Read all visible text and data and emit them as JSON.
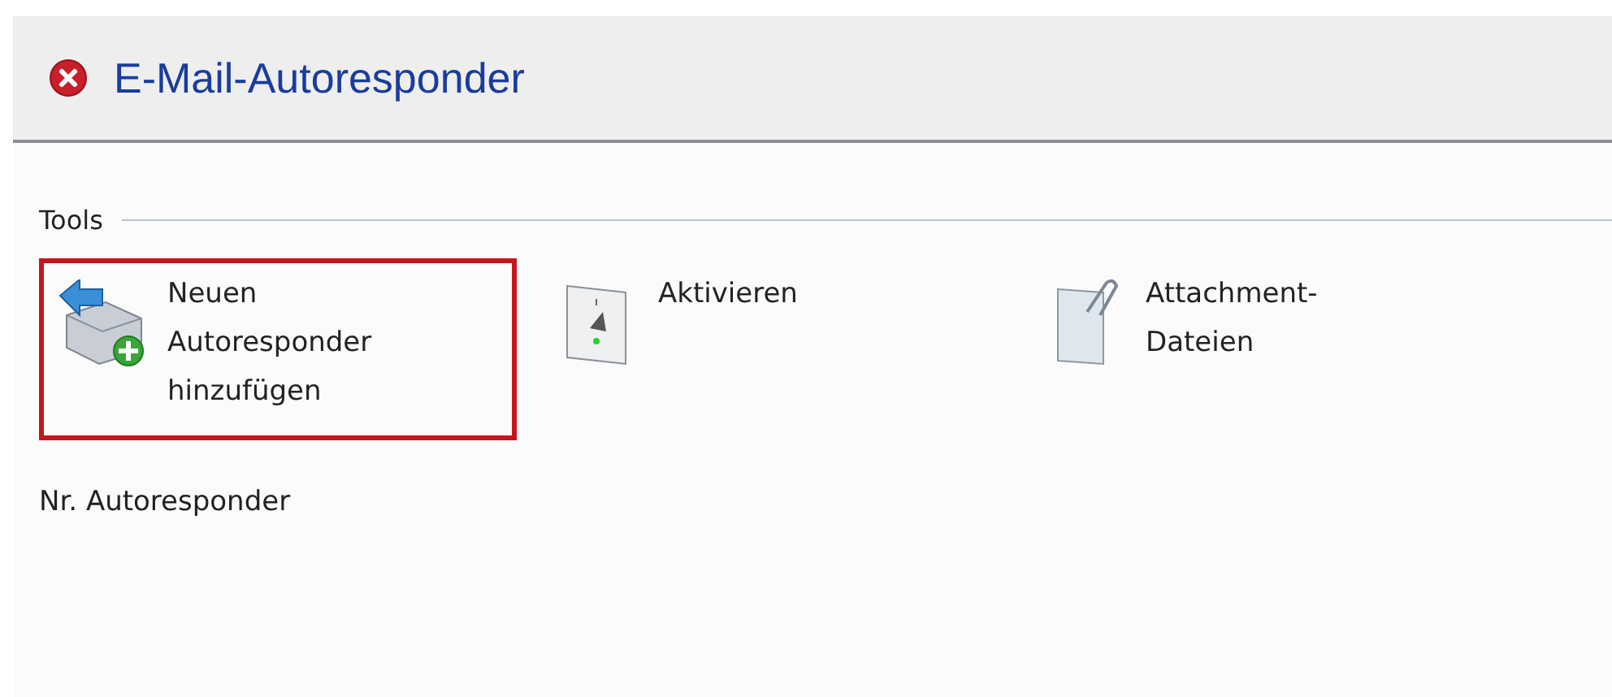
{
  "header": {
    "title": "E-Mail-Autoresponder"
  },
  "tools_section": {
    "label": "Tools",
    "items": [
      {
        "kind": "add-mail",
        "label": "Neuen Autoresponder hinzufügen",
        "selected": true
      },
      {
        "kind": "switch",
        "label": "Aktivieren",
        "selected": false
      },
      {
        "kind": "attachment",
        "label": "Attachment-Dateien",
        "selected": false
      }
    ]
  },
  "list_label": "Nr. Autoresponder"
}
